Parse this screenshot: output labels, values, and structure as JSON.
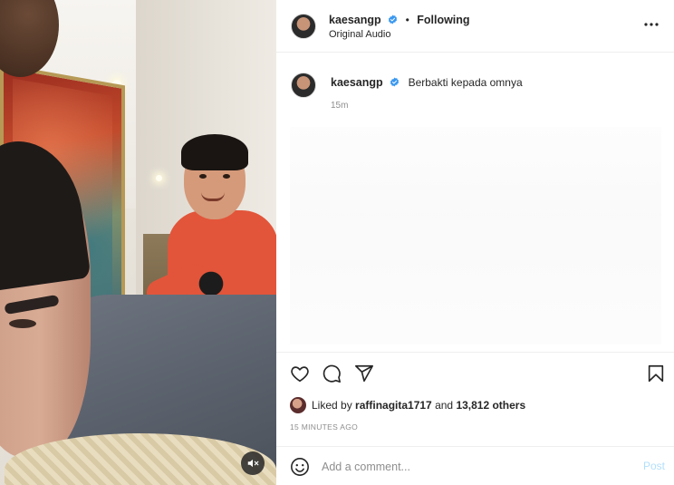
{
  "media": {
    "mute_icon": "speaker-muted-icon"
  },
  "header": {
    "username": "kaesangp",
    "separator": "•",
    "follow_status": "Following",
    "subtitle": "Original Audio",
    "more_icon": "more-horizontal-icon",
    "more_label": "..."
  },
  "caption": {
    "username": "kaesangp",
    "text": "Berbakti kepada omnya",
    "time": "15m"
  },
  "actions": {
    "like_icon": "heart-icon",
    "comment_icon": "comment-icon",
    "share_icon": "send-icon",
    "save_icon": "bookmark-icon"
  },
  "likes": {
    "prefix": "Liked by ",
    "liker": "raffinagita1717",
    "middle": " and ",
    "others": "13,812 others"
  },
  "timestamp": "15 MINUTES AGO",
  "comment": {
    "emoji_icon": "smiley-icon",
    "placeholder": "Add a comment...",
    "post_label": "Post"
  },
  "colors": {
    "verified": "#3897f0",
    "post_disabled": "#b2dffc",
    "muted_text": "#8e8e8e"
  }
}
